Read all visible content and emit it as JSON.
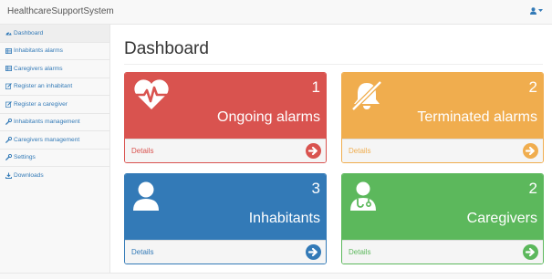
{
  "navbar": {
    "brand": "HealthcareSupportSystem",
    "user_icon": "user-icon",
    "caret_icon": "caret-down-icon"
  },
  "sidebar": {
    "items": [
      {
        "label": "Dashboard",
        "icon": "dashboard-icon",
        "active": true
      },
      {
        "label": "Inhabitants alarms",
        "icon": "table-icon"
      },
      {
        "label": "Caregivers alarms",
        "icon": "table-icon"
      },
      {
        "label": "Register an inhabitant",
        "icon": "edit-icon"
      },
      {
        "label": "Register a caregiver",
        "icon": "edit-icon"
      },
      {
        "label": "Inhabitants management",
        "icon": "wrench-icon"
      },
      {
        "label": "Caregivers management",
        "icon": "wrench-icon"
      },
      {
        "label": "Settings",
        "icon": "wrench-icon"
      },
      {
        "label": "Downloads",
        "icon": "download-icon"
      }
    ]
  },
  "main": {
    "title": "Dashboard",
    "panels": [
      {
        "count": "1",
        "label": "Ongoing alarms",
        "details": "Details",
        "icon": "heartbeat-icon",
        "color": "#d9534f"
      },
      {
        "count": "2",
        "label": "Terminated alarms",
        "details": "Details",
        "icon": "bell-slash-icon",
        "color": "#f0ad4e"
      },
      {
        "count": "3",
        "label": "Inhabitants",
        "details": "Details",
        "icon": "user-icon",
        "color": "#337ab7"
      },
      {
        "count": "2",
        "label": "Caregivers",
        "details": "Details",
        "icon": "user-md-icon",
        "color": "#5cb85c"
      }
    ]
  }
}
